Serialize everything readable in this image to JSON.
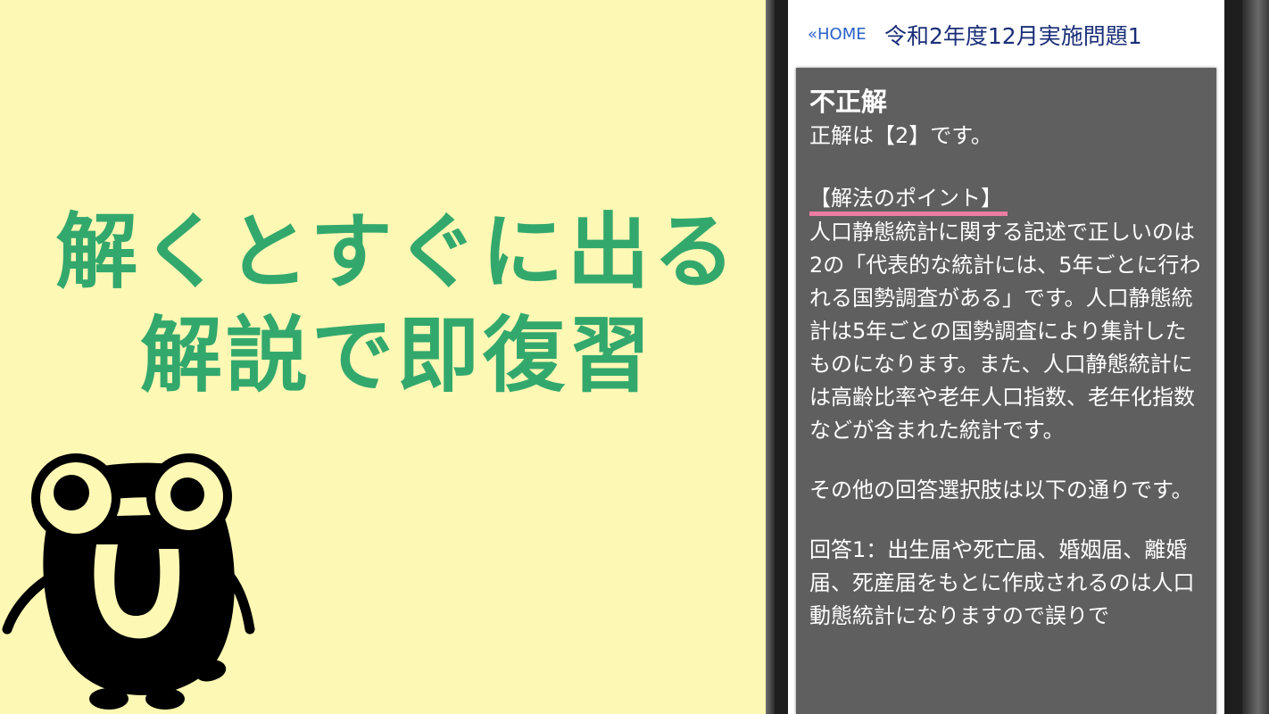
{
  "headline": {
    "line1": "解くとすぐに出る",
    "line2": "解説で即復習"
  },
  "colors": {
    "background": "#fdf8b4",
    "headline": "#33a86d",
    "card": "#5f5f5f",
    "link": "#2a62c9",
    "title": "#1a2e78",
    "underline": "#ec7ca2"
  },
  "app": {
    "home_label": "«HOME",
    "title": "令和2年度12月実施問題1"
  },
  "answer": {
    "result": "不正解",
    "correct": "正解は【2】です。",
    "point_heading": "【解法のポイント】",
    "explanation": "人口静態統計に関する記述で正しいのは2の「代表的な統計には、5年ごとに行われる国勢調査がある」です。人口静態統計は5年ごとの国勢調査により集計したものになります。また、人口静態統計には高齢比率や老年人口指数、老年化指数などが含まれた統計です。",
    "other_intro": "その他の回答選択肢は以下の通りです。",
    "option1": "回答1：出生届や死亡届、婚姻届、離婚届、死産届をもとに作成されるのは人口動態統計になりますので誤りで"
  },
  "mascot": {
    "icon": "mascot-character"
  }
}
